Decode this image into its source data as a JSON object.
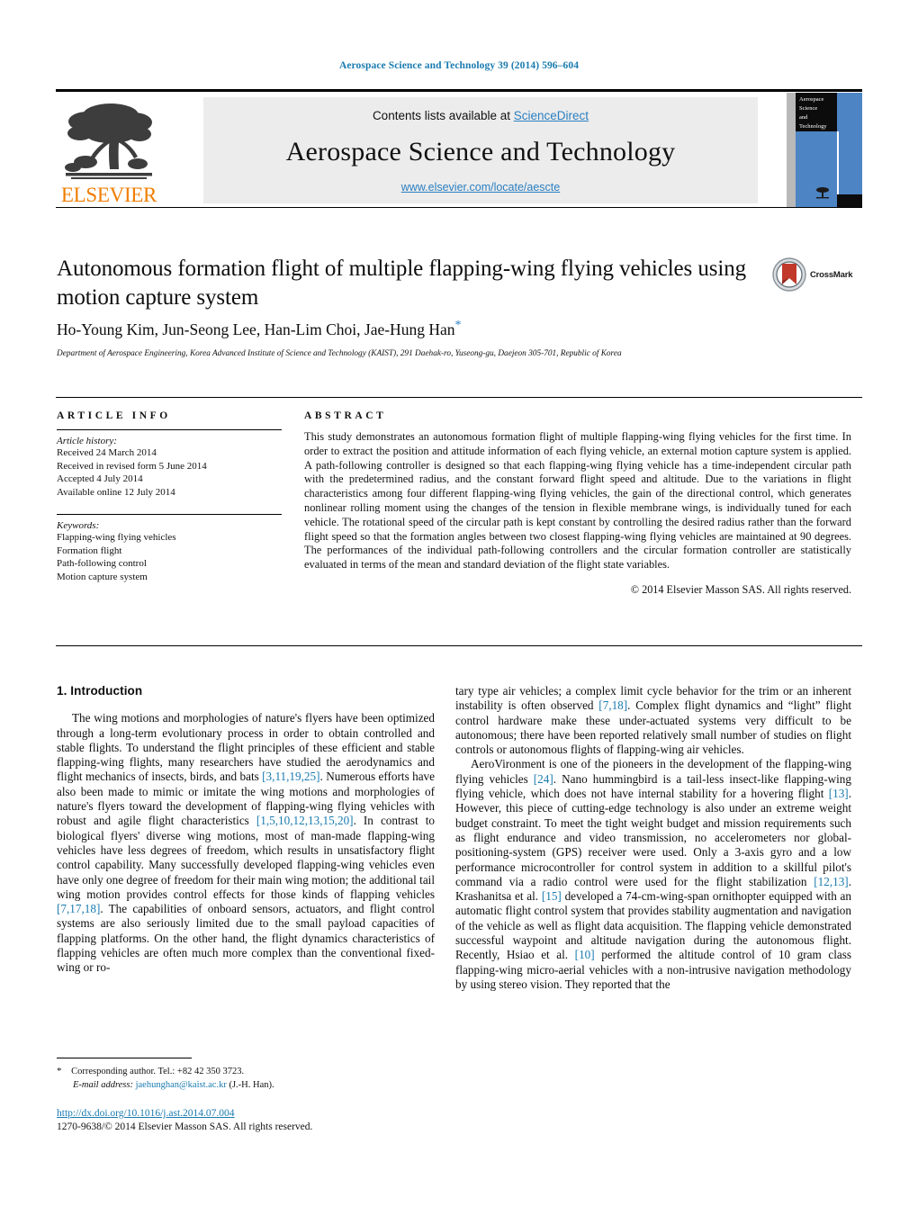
{
  "running_head": "Aerospace Science and Technology 39 (2014) 596–604",
  "journal_header": {
    "contents_prefix": "Contents lists available at ",
    "sciencedirect": "ScienceDirect",
    "journal_title": "Aerospace Science and Technology",
    "url": "www.elsevier.com/locate/aescte",
    "publisher_logo_text": "ELSEVIER",
    "cover_lines": [
      "Aerospace",
      "Science",
      "and",
      "Technology"
    ]
  },
  "article": {
    "title": "Autonomous formation flight of multiple flapping-wing flying vehicles using motion capture system",
    "crossmark_label": "CrossMark",
    "authors": "Ho-Young Kim, Jun-Seong Lee, Han-Lim Choi, Jae-Hung Han",
    "author_marker": "*",
    "affiliation": "Department of Aerospace Engineering, Korea Advanced Institute of Science and Technology (KAIST), 291 Daehak-ro, Yuseong-gu, Daejeon 305-701, Republic of Korea"
  },
  "info": {
    "heading": "ARTICLE INFO",
    "history_label": "Article history:",
    "history": [
      "Received 24 March 2014",
      "Received in revised form 5 June 2014",
      "Accepted 4 July 2014",
      "Available online 12 July 2014"
    ],
    "keywords_label": "Keywords:",
    "keywords": [
      "Flapping-wing flying vehicles",
      "Formation flight",
      "Path-following control",
      "Motion capture system"
    ]
  },
  "abstract": {
    "heading": "ABSTRACT",
    "text": "This study demonstrates an autonomous formation flight of multiple flapping-wing flying vehicles for the first time. In order to extract the position and attitude information of each flying vehicle, an external motion capture system is applied. A path-following controller is designed so that each flapping-wing flying vehicle has a time-independent circular path with the predetermined radius, and the constant forward flight speed and altitude. Due to the variations in flight characteristics among four different flapping-wing flying vehicles, the gain of the directional control, which generates nonlinear rolling moment using the changes of the tension in flexible membrane wings, is individually tuned for each vehicle. The rotational speed of the circular path is kept constant by controlling the desired radius rather than the forward flight speed so that the formation angles between two closest flapping-wing flying vehicles are maintained at 90 degrees. The performances of the individual path-following controllers and the circular formation controller are statistically evaluated in terms of the mean and standard deviation of the flight state variables.",
    "copyright": "© 2014 Elsevier Masson SAS. All rights reserved."
  },
  "introduction": {
    "heading": "1. Introduction",
    "left_para_1_a": "The wing motions and morphologies of nature's flyers have been optimized through a long-term evolutionary process in order to obtain controlled and stable flights. To understand the flight principles of these efficient and stable flapping-wing flights, many researchers have studied the aerodynamics and flight mechanics of insects, birds, and bats ",
    "ref_1": "[3,11,19,25]",
    "left_para_1_b": ". Numerous efforts have also been made to mimic or imitate the wing motions and morphologies of nature's flyers toward the development of flapping-wing flying vehicles with robust and agile flight characteristics ",
    "ref_2": "[1,5,10,12,13,15,20]",
    "left_para_1_c": ". In contrast to biological flyers' diverse wing motions, most of man-made flapping-wing vehicles have less degrees of freedom, which results in unsatisfactory flight control capability. Many successfully developed flapping-wing vehicles even have only one degree of freedom for their main wing motion; the additional tail wing motion provides control effects for those kinds of flapping vehicles ",
    "ref_3": "[7,17,18]",
    "left_para_1_d": ". The capabilities of onboard sensors, actuators, and flight control systems are also seriously limited due to the small payload capacities of flapping platforms. On the other hand, the flight dynamics characteristics of flapping vehicles are often much more complex than the conventional fixed-wing or ro-",
    "right_para_1_a": "tary type air vehicles; a complex limit cycle behavior for the trim or an inherent instability is often observed ",
    "ref_4": "[7,18]",
    "right_para_1_b": ". Complex flight dynamics and “light” flight control hardware make these under-actuated systems very difficult to be autonomous; there have been reported relatively small number of studies on flight controls or autonomous flights of flapping-wing air vehicles.",
    "right_para_2_a": "AeroVironment is one of the pioneers in the development of the flapping-wing flying vehicles ",
    "ref_5": "[24]",
    "right_para_2_b": ". Nano hummingbird is a tail-less insect-like flapping-wing flying vehicle, which does not have internal stability for a hovering flight ",
    "ref_6": "[13]",
    "right_para_2_c": ". However, this piece of cutting-edge technology is also under an extreme weight budget constraint. To meet the tight weight budget and mission requirements such as flight endurance and video transmission, no accelerometers nor global-positioning-system (GPS) receiver were used. Only a 3-axis gyro and a low performance microcontroller for control system in addition to a skillful pilot's command via a radio control were used for the flight stabilization ",
    "ref_7": "[12,13]",
    "right_para_2_d": ". Krashanitsa et al. ",
    "ref_8": "[15]",
    "right_para_2_e": " developed a 74-cm-wing-span ornithopter equipped with an automatic flight control system that provides stability augmentation and navigation of the vehicle as well as flight data acquisition. The flapping vehicle demonstrated successful waypoint and altitude navigation during the autonomous flight. Recently, Hsiao et al. ",
    "ref_9": "[10]",
    "right_para_2_f": " performed the altitude control of 10 gram class flapping-wing micro-aerial vehicles with a non-intrusive navigation methodology by using stereo vision. They reported that the"
  },
  "footer": {
    "corresponding_marker": "*",
    "corresponding_text": "Corresponding author. Tel.: +82 42 350 3723.",
    "email_label": "E-mail address:",
    "email": "jaehunghan@kaist.ac.kr",
    "email_suffix": "(J.-H. Han).",
    "doi": "http://dx.doi.org/10.1016/j.ast.2014.07.004",
    "issn_line": "1270-9638/© 2014 Elsevier Masson SAS. All rights reserved."
  },
  "colors": {
    "link_blue": "#1a7bb0",
    "elsevier_orange": "#F07D00",
    "banner_gray": "#ececec",
    "cover_blue": "#4d84c4"
  }
}
